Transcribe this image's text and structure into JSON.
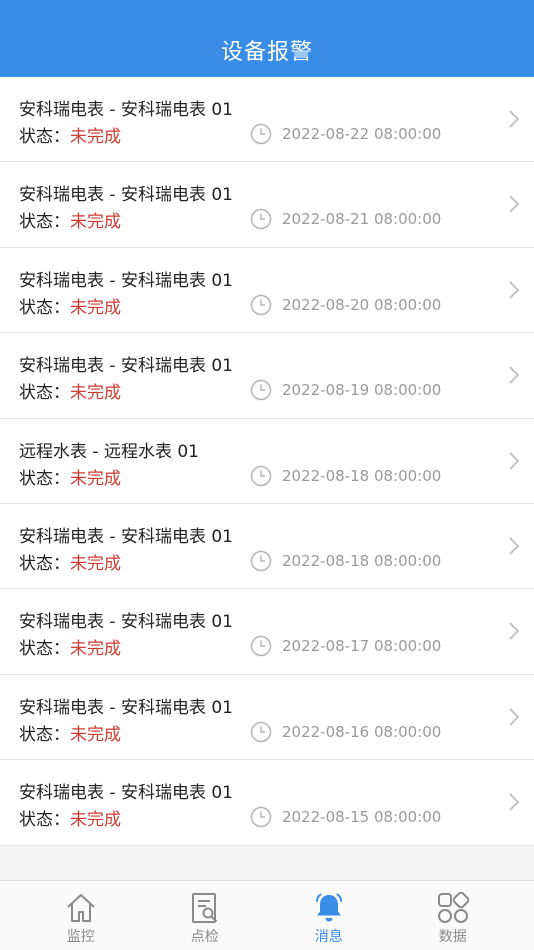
{
  "header": {
    "title": "设备报警"
  },
  "status_label": "状态：",
  "items": [
    {
      "name": "安科瑞电表 - 安科瑞电表 01",
      "status": "未完成",
      "time": "2022-08-22 08:00:00"
    },
    {
      "name": "安科瑞电表 - 安科瑞电表 01",
      "status": "未完成",
      "time": "2022-08-21 08:00:00"
    },
    {
      "name": "安科瑞电表 - 安科瑞电表 01",
      "status": "未完成",
      "time": "2022-08-20 08:00:00"
    },
    {
      "name": "安科瑞电表 - 安科瑞电表 01",
      "status": "未完成",
      "time": "2022-08-19 08:00:00"
    },
    {
      "name": "远程水表 - 远程水表 01",
      "status": "未完成",
      "time": "2022-08-18 08:00:00"
    },
    {
      "name": "安科瑞电表 - 安科瑞电表 01",
      "status": "未完成",
      "time": "2022-08-18 08:00:00"
    },
    {
      "name": "安科瑞电表 - 安科瑞电表 01",
      "status": "未完成",
      "time": "2022-08-17 08:00:00"
    },
    {
      "name": "安科瑞电表 - 安科瑞电表 01",
      "status": "未完成",
      "time": "2022-08-16 08:00:00"
    },
    {
      "name": "安科瑞电表 - 安科瑞电表 01",
      "status": "未完成",
      "time": "2022-08-15 08:00:00"
    }
  ],
  "tabs": [
    {
      "label": "监控",
      "icon": "home-icon",
      "active": false
    },
    {
      "label": "点检",
      "icon": "inspection-icon",
      "active": false
    },
    {
      "label": "消息",
      "icon": "bell-icon",
      "active": true
    },
    {
      "label": "数据",
      "icon": "grid-icon",
      "active": false
    }
  ],
  "colors": {
    "brand": "#3a8de6",
    "status_incomplete": "#cf3b32"
  }
}
